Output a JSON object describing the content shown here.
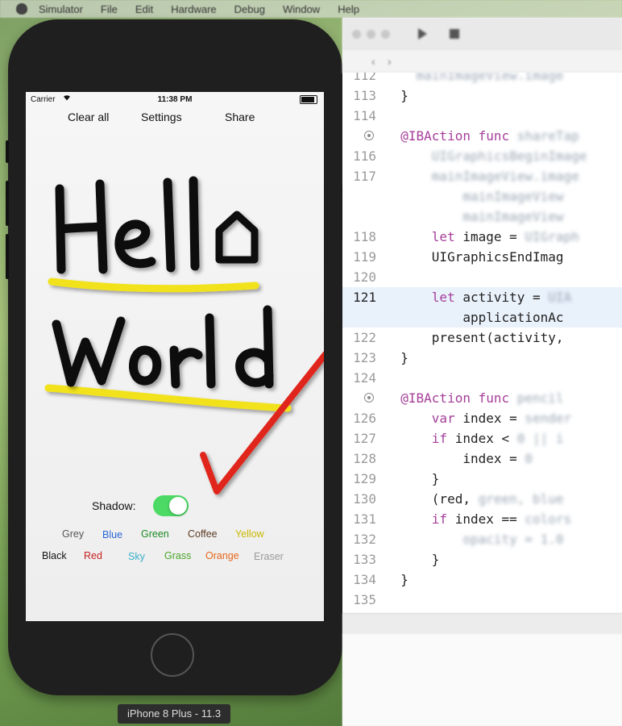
{
  "menubar": {
    "items": [
      "Simulator",
      "File",
      "Edit",
      "Hardware",
      "Debug",
      "Window",
      "Help"
    ]
  },
  "simulator": {
    "device_label": "iPhone 8 Plus - 11.3",
    "status": {
      "carrier": "Carrier",
      "time": "11:38 PM"
    },
    "toolbar": {
      "clear": "Clear all",
      "settings": "Settings",
      "share": "Share"
    },
    "drawing": {
      "line1": "Hello",
      "line2": "World",
      "ink_color": "#111111",
      "underline_color": "#f2e21a",
      "check_color": "#e0281b"
    },
    "shadow": {
      "label": "Shadow:",
      "on": true,
      "on_color": "#4cd964"
    },
    "colors_row1": [
      {
        "label": "Grey",
        "color": "#555555"
      },
      {
        "label": "Blue",
        "color": "#2a66d6"
      },
      {
        "label": "Green",
        "color": "#1a8a23"
      },
      {
        "label": "Coffee",
        "color": "#5b3a22"
      },
      {
        "label": "Yellow",
        "color": "#c9b800"
      }
    ],
    "colors_row2": [
      {
        "label": "Black",
        "color": "#111111"
      },
      {
        "label": "Red",
        "color": "#c62020"
      },
      {
        "label": "Sky",
        "color": "#3ab0c8"
      },
      {
        "label": "Grass",
        "color": "#4aa52a"
      },
      {
        "label": "Orange",
        "color": "#e8661a"
      },
      {
        "label": "Eraser",
        "color": "#9a9a9a"
      }
    ]
  },
  "xcode": {
    "lines": [
      {
        "n": "112",
        "code": [
          [
            "blur",
            "    mainImageView.image"
          ]
        ]
      },
      {
        "n": "113",
        "code": [
          [
            "",
            "  }"
          ]
        ]
      },
      {
        "n": "114",
        "code": []
      },
      {
        "n": "",
        "bp": true,
        "code": [
          [
            "kw",
            "  @IBAction func "
          ],
          [
            "blur",
            "shareTap"
          ]
        ]
      },
      {
        "n": "116",
        "code": [
          [
            "",
            "      "
          ],
          [
            "blur",
            "UIGraphicsBeginImage"
          ]
        ]
      },
      {
        "n": "117",
        "code": [
          [
            "",
            "      "
          ],
          [
            "blur",
            "mainImageView.image"
          ]
        ]
      },
      {
        "n": "",
        "code": [
          [
            "",
            "          "
          ],
          [
            "blur",
            "mainImageView"
          ]
        ]
      },
      {
        "n": "",
        "code": [
          [
            "",
            "          "
          ],
          [
            "blur",
            "mainImageView"
          ]
        ]
      },
      {
        "n": "118",
        "code": [
          [
            "kw",
            "      let"
          ],
          [
            "",
            " image = "
          ],
          [
            "blur",
            "UIGraph"
          ]
        ]
      },
      {
        "n": "119",
        "code": [
          [
            "",
            "      UIGraphicsEndImag"
          ]
        ]
      },
      {
        "n": "120",
        "code": []
      },
      {
        "n": "121",
        "current": true,
        "code": [
          [
            "kw",
            "      let"
          ],
          [
            "",
            " activity = "
          ],
          [
            "blur",
            "UIA"
          ]
        ]
      },
      {
        "n": "",
        "current": true,
        "code": [
          [
            "",
            "          applicationAc"
          ]
        ]
      },
      {
        "n": "122",
        "code": [
          [
            "",
            "      present(activity,"
          ]
        ]
      },
      {
        "n": "123",
        "code": [
          [
            "",
            "  }"
          ]
        ]
      },
      {
        "n": "124",
        "code": []
      },
      {
        "n": "",
        "bp": true,
        "code": [
          [
            "kw",
            "  @IBAction func "
          ],
          [
            "blur",
            "pencil"
          ]
        ]
      },
      {
        "n": "126",
        "code": [
          [
            "kw",
            "      var"
          ],
          [
            "",
            " index = "
          ],
          [
            "blur",
            "sender"
          ]
        ]
      },
      {
        "n": "127",
        "code": [
          [
            "kw",
            "      if"
          ],
          [
            "",
            " index < "
          ],
          [
            "blur",
            "0 || i"
          ]
        ]
      },
      {
        "n": "128",
        "code": [
          [
            "",
            "          index = "
          ],
          [
            "blur",
            "0"
          ]
        ]
      },
      {
        "n": "129",
        "code": [
          [
            "",
            "      }"
          ]
        ]
      },
      {
        "n": "130",
        "code": [
          [
            "",
            "      (red, "
          ],
          [
            "blur",
            "green, blue"
          ]
        ]
      },
      {
        "n": "131",
        "code": [
          [
            "kw",
            "      if"
          ],
          [
            "",
            " index == "
          ],
          [
            "blur",
            "colors"
          ]
        ]
      },
      {
        "n": "132",
        "code": [
          [
            "",
            "          "
          ],
          [
            "blur",
            "opacity = 1.0"
          ]
        ]
      },
      {
        "n": "133",
        "code": [
          [
            "",
            "      }"
          ]
        ]
      },
      {
        "n": "134",
        "code": [
          [
            "",
            "  }"
          ]
        ]
      },
      {
        "n": "135",
        "code": []
      }
    ]
  }
}
